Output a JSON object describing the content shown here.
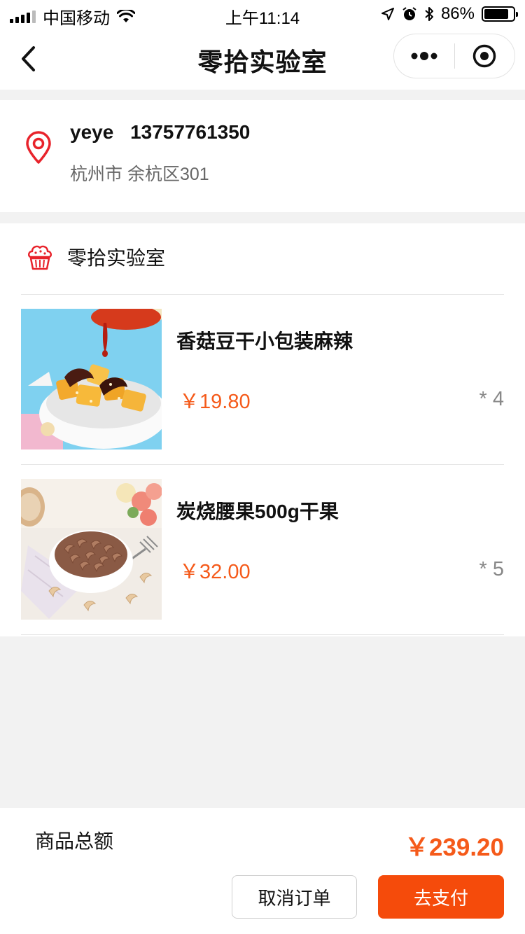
{
  "status_bar": {
    "carrier": "中国移动",
    "time": "上午11:14",
    "battery": "86%",
    "battery_level": 0.86,
    "icons": [
      "signal-icon",
      "wifi-icon",
      "location-arrow-icon",
      "alarm-icon",
      "bluetooth-icon",
      "battery-icon"
    ]
  },
  "nav": {
    "title": "零拾实验室",
    "icons": [
      "back-icon",
      "more-icon",
      "target-icon"
    ]
  },
  "address": {
    "name": "yeye",
    "phone": "13757761350",
    "detail": "杭州市 余杭区301",
    "icon": "location-pin-icon"
  },
  "shop": {
    "name": "零拾实验室",
    "icon": "muffin-icon"
  },
  "items": [
    {
      "title": "香菇豆干小包装麻辣",
      "price": "￥19.80",
      "qty": "* 4"
    },
    {
      "title": "炭烧腰果500g干果",
      "price": "￥32.00",
      "qty": "* 5"
    }
  ],
  "summary": {
    "total_label": "商品总额",
    "total_value": "￥239.20"
  },
  "actions": {
    "cancel": "取消订单",
    "pay": "去支付"
  },
  "colors": {
    "accent": "#f55a1a",
    "pay_button": "#f54b0b",
    "background": "#f2f2f2"
  }
}
